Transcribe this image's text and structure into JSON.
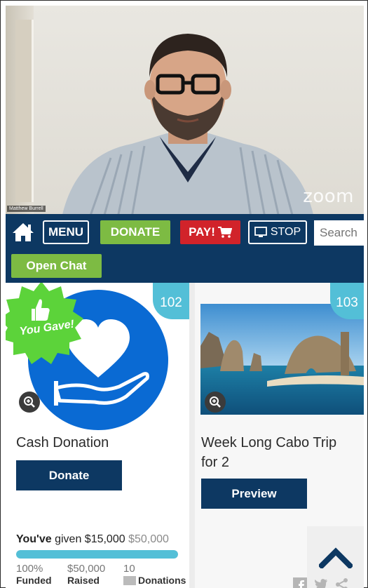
{
  "video": {
    "participant_name": "Matthew Burrell",
    "logo": "zoom"
  },
  "nav": {
    "home_icon": "home-icon",
    "menu_label": "MENU",
    "donate_label": "DONATE",
    "pay_label": "PAY!",
    "cart_icon": "cart-icon",
    "stop_label": "STOP",
    "monitor_icon": "monitor-icon",
    "search_placeholder": "Search",
    "open_chat_label": "Open Chat",
    "colors": {
      "navy": "#0d3862",
      "green": "#7dbb43",
      "red": "#d1232a",
      "teal": "#53bfd7"
    }
  },
  "items": [
    {
      "number": "102",
      "title": "Cash Donation",
      "button_label": "Donate",
      "badge_text": "You Gave!",
      "image_icon": "hand-heart-icon",
      "given": {
        "prefix": "You've",
        "text": "given $15,000",
        "goal": "$50,000",
        "progress": 1.0
      },
      "stats": [
        {
          "value": "100%",
          "label": "Funded"
        },
        {
          "value": "$50,000",
          "label": "Raised"
        },
        {
          "value": "10",
          "label": "Donations"
        }
      ]
    },
    {
      "number": "103",
      "title": "Week Long Cabo Trip for 2",
      "button_label": "Preview",
      "image_icon": "cabo-arch-photo"
    }
  ],
  "scroll_top_icon": "chevron-up-icon",
  "share_icons": [
    "facebook-icon",
    "twitter-icon",
    "share-icon"
  ]
}
